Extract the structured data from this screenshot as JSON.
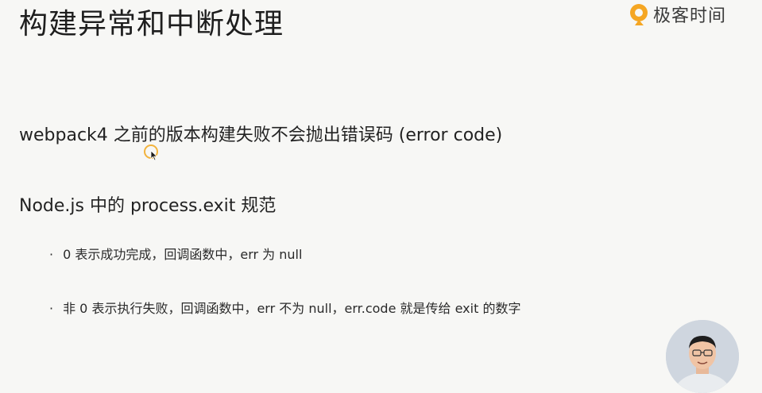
{
  "slide": {
    "title": "构建异常和中断处理",
    "logo_text": "极客时间",
    "line1": "webpack4 之前的版本构建失败不会抛出错误码 (error code)",
    "line2": "Node.js 中的 process.exit 规范",
    "bullets": [
      "0 表示成功完成，回调函数中，err 为 null",
      "非 0 表示执行失败，回调函数中，err 不为 null，err.code 就是传给 exit 的数字"
    ],
    "bullet_marker": "·"
  },
  "colors": {
    "background": "#f7f7f5",
    "logo_orange": "#f5a623",
    "cursor_ring": "#f2b33d"
  },
  "icons": {
    "logo": "geektime-logo-icon",
    "cursor": "mouse-cursor-icon"
  }
}
